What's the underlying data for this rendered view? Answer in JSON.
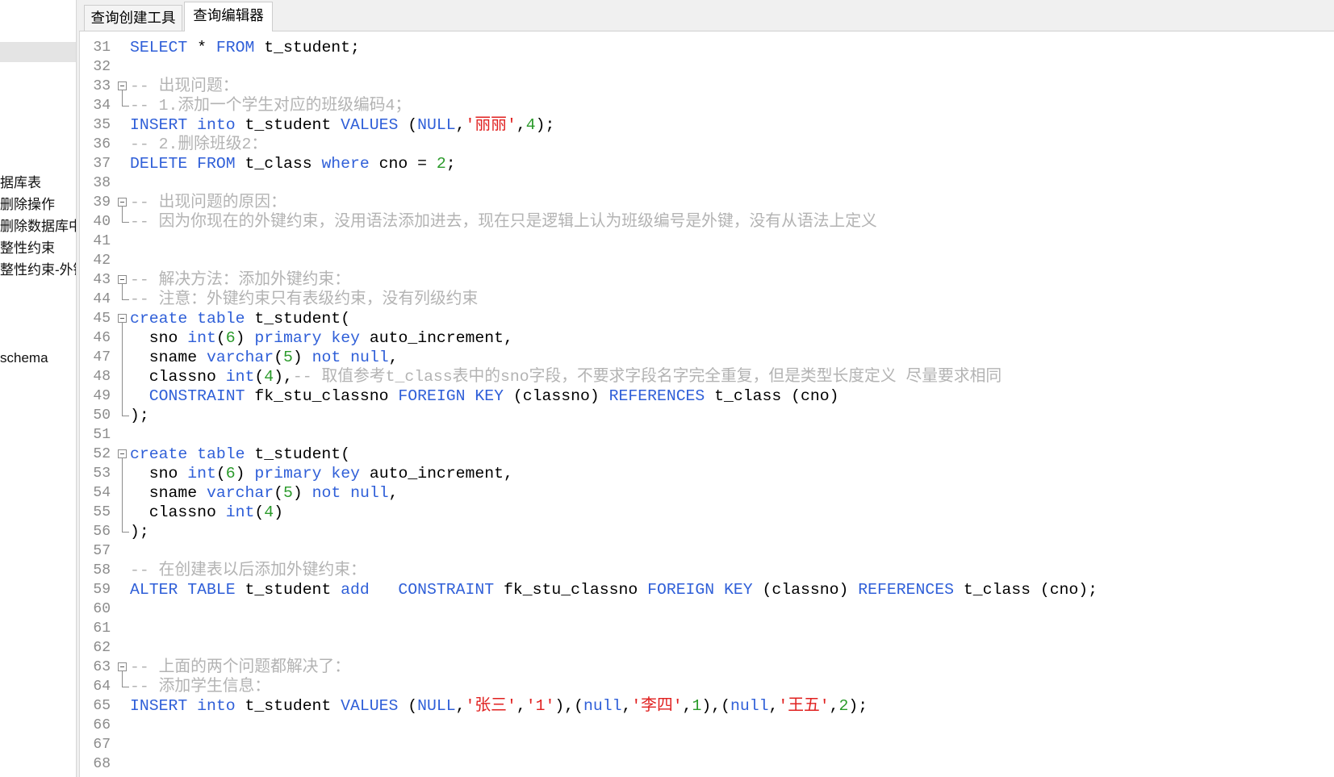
{
  "sidebar": {
    "items": [
      {
        "label": "据库表"
      },
      {
        "label": "删除操作"
      },
      {
        "label": "删除数据库中"
      },
      {
        "label": "整性约束"
      },
      {
        "label": "整性约束-外键"
      },
      {
        "label": "schema"
      }
    ]
  },
  "tabs": [
    {
      "label": "查询创建工具",
      "active": false
    },
    {
      "label": "查询编辑器",
      "active": true
    }
  ],
  "editor": {
    "colors": {
      "kw": "#2f5fd8",
      "id": "#000000",
      "str": "#e0201f",
      "num": "#2a9a2a",
      "cmt": "#b3b3b3",
      "line_number": "#8c8c8c"
    },
    "lines": [
      {
        "n": 31,
        "tokens": [
          {
            "t": "SELECT",
            "c": "kw"
          },
          {
            "t": " * ",
            "c": "id"
          },
          {
            "t": "FROM",
            "c": "kw"
          },
          {
            "t": " t_student;",
            "c": "id"
          }
        ]
      },
      {
        "n": 32,
        "tokens": []
      },
      {
        "n": 33,
        "fold": "fold-minus-icon",
        "tokens": [
          {
            "t": "-- 出现问题：",
            "c": "cmt"
          }
        ]
      },
      {
        "n": 34,
        "fold": "fold-guide-end",
        "tokens": [
          {
            "t": "-- 1.添加一个学生对应的班级编码4；",
            "c": "cmt"
          }
        ]
      },
      {
        "n": 35,
        "tokens": [
          {
            "t": "INSERT",
            "c": "kw"
          },
          {
            "t": " ",
            "c": "id"
          },
          {
            "t": "into",
            "c": "kw"
          },
          {
            "t": " t_student ",
            "c": "id"
          },
          {
            "t": "VALUES",
            "c": "kw"
          },
          {
            "t": " (",
            "c": "id"
          },
          {
            "t": "NULL",
            "c": "kw"
          },
          {
            "t": ",",
            "c": "id"
          },
          {
            "t": "'丽丽'",
            "c": "str"
          },
          {
            "t": ",",
            "c": "id"
          },
          {
            "t": "4",
            "c": "num"
          },
          {
            "t": ");",
            "c": "id"
          }
        ]
      },
      {
        "n": 36,
        "tokens": [
          {
            "t": "-- 2.删除班级2：",
            "c": "cmt"
          }
        ]
      },
      {
        "n": 37,
        "tokens": [
          {
            "t": "DELETE",
            "c": "kw"
          },
          {
            "t": " ",
            "c": "id"
          },
          {
            "t": "FROM",
            "c": "kw"
          },
          {
            "t": " t_class ",
            "c": "id"
          },
          {
            "t": "where",
            "c": "kw"
          },
          {
            "t": " cno = ",
            "c": "id"
          },
          {
            "t": "2",
            "c": "num"
          },
          {
            "t": ";",
            "c": "id"
          }
        ]
      },
      {
        "n": 38,
        "tokens": []
      },
      {
        "n": 39,
        "fold": "fold-minus-icon",
        "tokens": [
          {
            "t": "-- 出现问题的原因：",
            "c": "cmt"
          }
        ]
      },
      {
        "n": 40,
        "fold": "fold-guide-end",
        "tokens": [
          {
            "t": "-- 因为你现在的外键约束，没用语法添加进去，现在只是逻辑上认为班级编号是外键，没有从语法上定义",
            "c": "cmt"
          }
        ]
      },
      {
        "n": 41,
        "tokens": []
      },
      {
        "n": 42,
        "tokens": []
      },
      {
        "n": 43,
        "fold": "fold-minus-icon",
        "tokens": [
          {
            "t": "-- 解决方法：添加外键约束：",
            "c": "cmt"
          }
        ]
      },
      {
        "n": 44,
        "fold": "fold-guide-end",
        "tokens": [
          {
            "t": "-- 注意：外键约束只有表级约束，没有列级约束",
            "c": "cmt"
          }
        ]
      },
      {
        "n": 45,
        "fold": "fold-minus-icon",
        "tokens": [
          {
            "t": "create",
            "c": "kw"
          },
          {
            "t": " ",
            "c": "id"
          },
          {
            "t": "table",
            "c": "kw"
          },
          {
            "t": " t_student(",
            "c": "id"
          }
        ]
      },
      {
        "n": 46,
        "fold": "fold-guide",
        "tokens": [
          {
            "t": "  sno ",
            "c": "id"
          },
          {
            "t": "int",
            "c": "kw"
          },
          {
            "t": "(",
            "c": "id"
          },
          {
            "t": "6",
            "c": "num"
          },
          {
            "t": ") ",
            "c": "id"
          },
          {
            "t": "primary",
            "c": "kw"
          },
          {
            "t": " ",
            "c": "id"
          },
          {
            "t": "key",
            "c": "kw"
          },
          {
            "t": " auto_increment,",
            "c": "id"
          }
        ]
      },
      {
        "n": 47,
        "fold": "fold-guide",
        "tokens": [
          {
            "t": "  sname ",
            "c": "id"
          },
          {
            "t": "varchar",
            "c": "kw"
          },
          {
            "t": "(",
            "c": "id"
          },
          {
            "t": "5",
            "c": "num"
          },
          {
            "t": ") ",
            "c": "id"
          },
          {
            "t": "not",
            "c": "kw"
          },
          {
            "t": " ",
            "c": "id"
          },
          {
            "t": "null",
            "c": "kw"
          },
          {
            "t": ",",
            "c": "id"
          }
        ]
      },
      {
        "n": 48,
        "fold": "fold-guide",
        "tokens": [
          {
            "t": "  classno ",
            "c": "id"
          },
          {
            "t": "int",
            "c": "kw"
          },
          {
            "t": "(",
            "c": "id"
          },
          {
            "t": "4",
            "c": "num"
          },
          {
            "t": "),",
            "c": "id"
          },
          {
            "t": "-- 取值参考t_class表中的sno字段，不要求字段名字完全重复，但是类型长度定义 尽量要求相同",
            "c": "cmt"
          }
        ]
      },
      {
        "n": 49,
        "fold": "fold-guide",
        "tokens": [
          {
            "t": "  ",
            "c": "id"
          },
          {
            "t": "CONSTRAINT",
            "c": "kw"
          },
          {
            "t": " fk_stu_classno ",
            "c": "id"
          },
          {
            "t": "FOREIGN",
            "c": "kw"
          },
          {
            "t": " ",
            "c": "id"
          },
          {
            "t": "KEY",
            "c": "kw"
          },
          {
            "t": " (classno) ",
            "c": "id"
          },
          {
            "t": "REFERENCES",
            "c": "kw"
          },
          {
            "t": " t_class (cno)",
            "c": "id"
          }
        ]
      },
      {
        "n": 50,
        "fold": "fold-guide-end",
        "tokens": [
          {
            "t": ");",
            "c": "id"
          }
        ]
      },
      {
        "n": 51,
        "tokens": []
      },
      {
        "n": 52,
        "fold": "fold-minus-icon",
        "tokens": [
          {
            "t": "create",
            "c": "kw"
          },
          {
            "t": " ",
            "c": "id"
          },
          {
            "t": "table",
            "c": "kw"
          },
          {
            "t": " t_student(",
            "c": "id"
          }
        ]
      },
      {
        "n": 53,
        "fold": "fold-guide",
        "tokens": [
          {
            "t": "  sno ",
            "c": "id"
          },
          {
            "t": "int",
            "c": "kw"
          },
          {
            "t": "(",
            "c": "id"
          },
          {
            "t": "6",
            "c": "num"
          },
          {
            "t": ") ",
            "c": "id"
          },
          {
            "t": "primary",
            "c": "kw"
          },
          {
            "t": " ",
            "c": "id"
          },
          {
            "t": "key",
            "c": "kw"
          },
          {
            "t": " auto_increment,",
            "c": "id"
          }
        ]
      },
      {
        "n": 54,
        "fold": "fold-guide",
        "tokens": [
          {
            "t": "  sname ",
            "c": "id"
          },
          {
            "t": "varchar",
            "c": "kw"
          },
          {
            "t": "(",
            "c": "id"
          },
          {
            "t": "5",
            "c": "num"
          },
          {
            "t": ") ",
            "c": "id"
          },
          {
            "t": "not",
            "c": "kw"
          },
          {
            "t": " ",
            "c": "id"
          },
          {
            "t": "null",
            "c": "kw"
          },
          {
            "t": ",",
            "c": "id"
          }
        ]
      },
      {
        "n": 55,
        "fold": "fold-guide",
        "tokens": [
          {
            "t": "  classno ",
            "c": "id"
          },
          {
            "t": "int",
            "c": "kw"
          },
          {
            "t": "(",
            "c": "id"
          },
          {
            "t": "4",
            "c": "num"
          },
          {
            "t": ")",
            "c": "id"
          }
        ]
      },
      {
        "n": 56,
        "fold": "fold-guide-end",
        "tokens": [
          {
            "t": ");",
            "c": "id"
          }
        ]
      },
      {
        "n": 57,
        "tokens": []
      },
      {
        "n": 58,
        "tokens": [
          {
            "t": "-- 在创建表以后添加外键约束：",
            "c": "cmt"
          }
        ]
      },
      {
        "n": 59,
        "tokens": [
          {
            "t": "ALTER",
            "c": "kw"
          },
          {
            "t": " ",
            "c": "id"
          },
          {
            "t": "TABLE",
            "c": "kw"
          },
          {
            "t": " t_student ",
            "c": "id"
          },
          {
            "t": "add",
            "c": "kw"
          },
          {
            "t": "   ",
            "c": "id"
          },
          {
            "t": "CONSTRAINT",
            "c": "kw"
          },
          {
            "t": " fk_stu_classno ",
            "c": "id"
          },
          {
            "t": "FOREIGN",
            "c": "kw"
          },
          {
            "t": " ",
            "c": "id"
          },
          {
            "t": "KEY",
            "c": "kw"
          },
          {
            "t": " (classno) ",
            "c": "id"
          },
          {
            "t": "REFERENCES",
            "c": "kw"
          },
          {
            "t": " t_class (cno);",
            "c": "id"
          }
        ]
      },
      {
        "n": 60,
        "tokens": []
      },
      {
        "n": 61,
        "tokens": []
      },
      {
        "n": 62,
        "tokens": []
      },
      {
        "n": 63,
        "fold": "fold-minus-icon",
        "tokens": [
          {
            "t": "-- 上面的两个问题都解决了：",
            "c": "cmt"
          }
        ]
      },
      {
        "n": 64,
        "fold": "fold-guide-end",
        "tokens": [
          {
            "t": "-- 添加学生信息：",
            "c": "cmt"
          }
        ]
      },
      {
        "n": 65,
        "tokens": [
          {
            "t": "INSERT",
            "c": "kw"
          },
          {
            "t": " ",
            "c": "id"
          },
          {
            "t": "into",
            "c": "kw"
          },
          {
            "t": " t_student ",
            "c": "id"
          },
          {
            "t": "VALUES",
            "c": "kw"
          },
          {
            "t": " (",
            "c": "id"
          },
          {
            "t": "NULL",
            "c": "kw"
          },
          {
            "t": ",",
            "c": "id"
          },
          {
            "t": "'张三'",
            "c": "str"
          },
          {
            "t": ",",
            "c": "id"
          },
          {
            "t": "'1'",
            "c": "str"
          },
          {
            "t": "),(",
            "c": "id"
          },
          {
            "t": "null",
            "c": "kw"
          },
          {
            "t": ",",
            "c": "id"
          },
          {
            "t": "'李四'",
            "c": "str"
          },
          {
            "t": ",",
            "c": "id"
          },
          {
            "t": "1",
            "c": "num"
          },
          {
            "t": "),(",
            "c": "id"
          },
          {
            "t": "null",
            "c": "kw"
          },
          {
            "t": ",",
            "c": "id"
          },
          {
            "t": "'王五'",
            "c": "str"
          },
          {
            "t": ",",
            "c": "id"
          },
          {
            "t": "2",
            "c": "num"
          },
          {
            "t": ");",
            "c": "id"
          }
        ]
      },
      {
        "n": 66,
        "tokens": []
      },
      {
        "n": 67,
        "tokens": []
      },
      {
        "n": 68,
        "tokens": []
      }
    ]
  }
}
